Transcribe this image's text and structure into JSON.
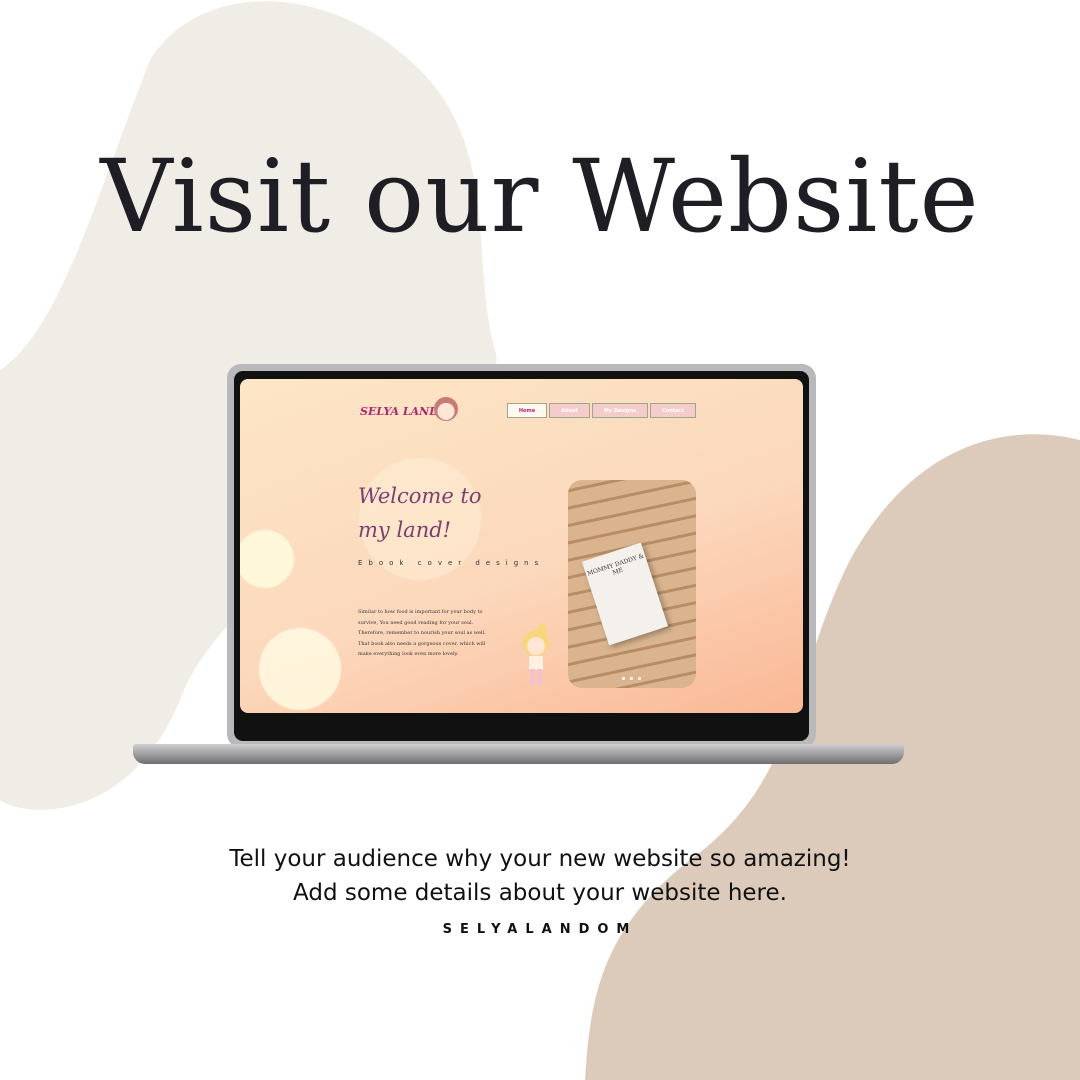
{
  "heading": "Visit our Website",
  "website": {
    "logo": "SELYA LAND",
    "nav": [
      {
        "label": "Home",
        "active": true
      },
      {
        "label": "About"
      },
      {
        "label": "My Designs"
      },
      {
        "label": "Contact"
      }
    ],
    "welcome": "Welcome to my land!",
    "subtitle": "Ebook cover designs",
    "paragraph": "Similar to how food is important for your body to survive, You need good reading for your soul. Therefore, remember to nourish your soul as well. That book also needs a gorgeous cover, which will make everything look even more lovely.",
    "book_title": "MOMMY DADDY & ME",
    "carousel_slides": 3
  },
  "caption_line1": "Tell your audience why your new website so amazing!",
  "caption_line2": "Add some details about your website here.",
  "brand": "SELYALANDOM",
  "colors": {
    "left_blob": "#f0ede6",
    "right_blob": "#dccbbb",
    "accent": "#b1266f"
  }
}
